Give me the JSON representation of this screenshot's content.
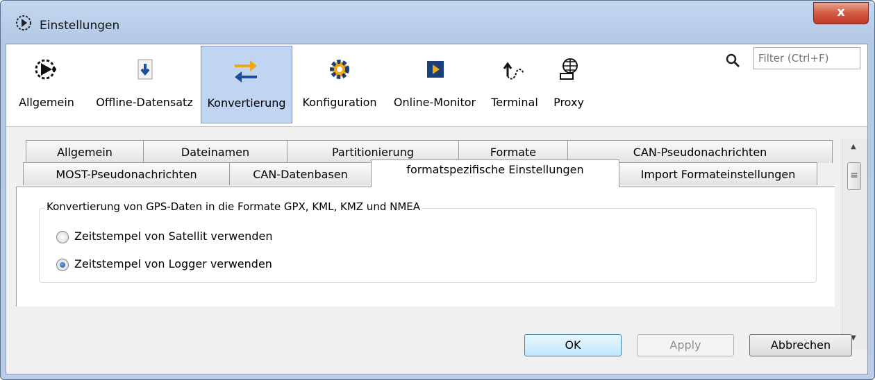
{
  "window": {
    "title": "Einstellungen",
    "close_label": "x"
  },
  "toolbar": {
    "items": [
      {
        "label": "Allgemein",
        "icon": "gear-dots-icon"
      },
      {
        "label": "Offline-Datensatz",
        "icon": "download-file-icon"
      },
      {
        "label": "Konvertierung",
        "icon": "convert-arrows-icon",
        "selected": true
      },
      {
        "label": "Konfiguration",
        "icon": "config-gear-icon"
      },
      {
        "label": "Online-Monitor",
        "icon": "monitor-play-icon"
      },
      {
        "label": "Terminal",
        "icon": "terminal-icon"
      },
      {
        "label": "Proxy",
        "icon": "proxy-globe-icon"
      }
    ],
    "filter_placeholder": "Filter (Ctrl+F)"
  },
  "tabs": {
    "row1": [
      "Allgemein",
      "Dateinamen",
      "Partitionierung",
      "Formate",
      "CAN-Pseudonachrichten"
    ],
    "row2": [
      "MOST-Pseudonachrichten",
      "CAN-Datenbasen",
      "formatspezifische Einstellungen",
      "Import Formateinstellungen"
    ],
    "active": "formatspezifische Einstellungen"
  },
  "gps_group": {
    "title": "Konvertierung von GPS-Daten in die Formate GPX, KML, KMZ und NMEA",
    "options": [
      {
        "label": "Zeitstempel von Satellit verwenden",
        "checked": false
      },
      {
        "label": "Zeitstempel von Logger verwenden",
        "checked": true
      }
    ]
  },
  "buttons": {
    "ok": "OK",
    "apply": "Apply",
    "cancel": "Abbrechen"
  },
  "colors": {
    "selected_tool_bg": "#bfd5f1",
    "accent_orange": "#f0a818",
    "accent_blue": "#1a4f9c",
    "close_red": "#c13c26"
  }
}
